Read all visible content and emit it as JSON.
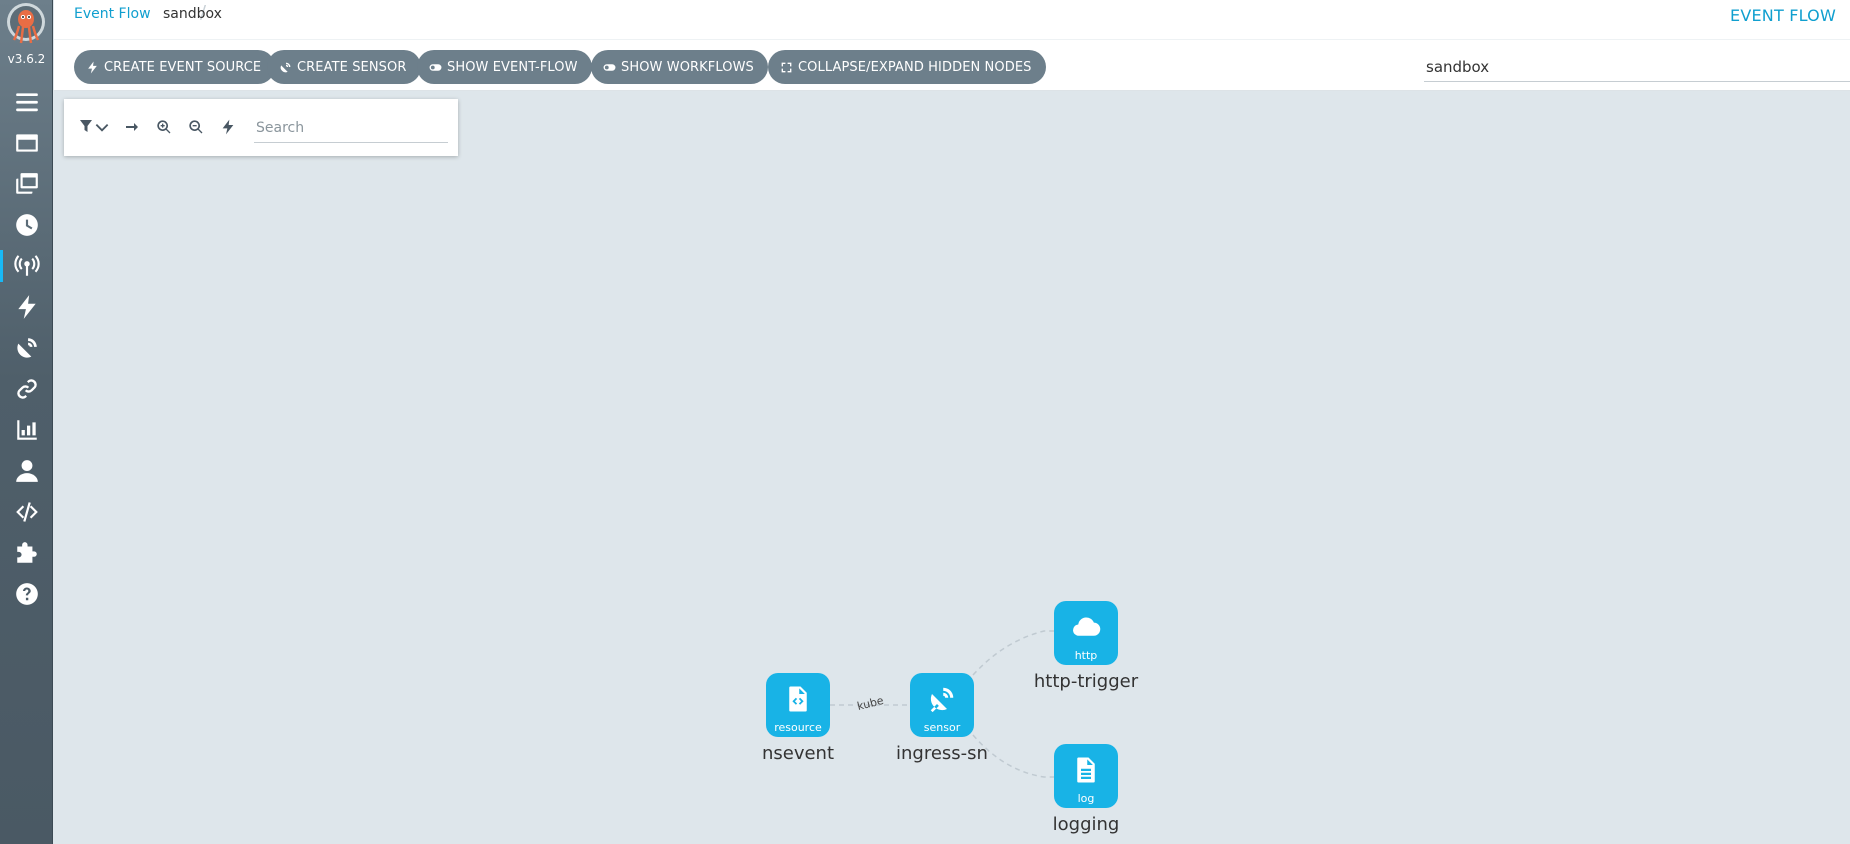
{
  "app": {
    "version": "v3.6.2"
  },
  "breadcrumb": {
    "parent": "Event Flow",
    "current": "sandbox"
  },
  "page_title": "EVENT FLOW",
  "toolbar": {
    "buttons": [
      {
        "label": "CREATE EVENT SOURCE",
        "icon": "bolt-icon"
      },
      {
        "label": "CREATE SENSOR",
        "icon": "satellite-dish-icon"
      },
      {
        "label": "SHOW EVENT-FLOW",
        "icon": "toggle-icon"
      },
      {
        "label": "SHOW WORKFLOWS",
        "icon": "toggle-icon"
      },
      {
        "label": "COLLAPSE/EXPAND HIDDEN NODES",
        "icon": "expand-icon"
      }
    ],
    "namespace_value": "sandbox"
  },
  "graph_panel": {
    "search_placeholder": "Search"
  },
  "sidebar": {
    "items": [
      "menu-icon",
      "workflows-icon",
      "workflow-templates-icon",
      "cron-workflows-icon",
      "event-flow-icon",
      "event-sources-icon",
      "sensors-icon",
      "event-bindings-icon",
      "reports-icon",
      "user-icon",
      "api-docs-icon",
      "plugins-icon",
      "help-icon"
    ],
    "active": "event-flow-icon"
  },
  "graph": {
    "nodes": [
      {
        "id": "nsevent",
        "type": "resource",
        "label": "nsevent",
        "icon": "file-code-icon"
      },
      {
        "id": "ingress-sn",
        "type": "sensor",
        "label": "ingress-sn",
        "icon": "satellite-dish-icon"
      },
      {
        "id": "http-trigger",
        "type": "http",
        "label": "http-trigger",
        "icon": "cloud-icon"
      },
      {
        "id": "logging",
        "type": "log",
        "label": "logging",
        "icon": "file-lines-icon"
      }
    ],
    "edges": [
      {
        "from": "nsevent",
        "to": "ingress-sn",
        "label": "kube"
      },
      {
        "from": "ingress-sn",
        "to": "http-trigger",
        "label": ""
      },
      {
        "from": "ingress-sn",
        "to": "logging",
        "label": ""
      }
    ]
  },
  "colors": {
    "accent": "#109fcf",
    "node": "#18b3e6",
    "sidebar": "#4f5f6a",
    "button": "#6d7f8b",
    "canvas": "#dee6eb"
  }
}
